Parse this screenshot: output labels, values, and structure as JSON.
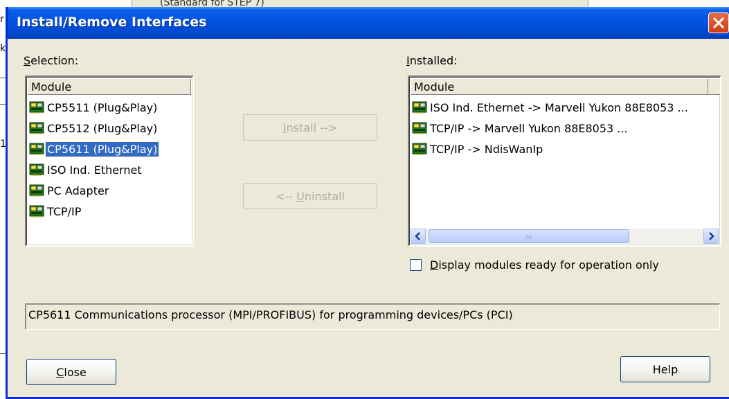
{
  "window": {
    "title": "Install/Remove Interfaces",
    "background_strip_text": "(Standard for STEP 7)",
    "close_glyph": "X"
  },
  "selection": {
    "label": "Selection:",
    "label_access_key": "S",
    "label_rest": "election:",
    "column_header": "Module",
    "items": [
      {
        "label": "CP5511 (Plug&Play)",
        "icon": "network-card-icon"
      },
      {
        "label": "CP5512 (Plug&Play)",
        "icon": "network-card-icon"
      },
      {
        "label": "CP5611 (Plug&Play)",
        "icon": "network-card-icon",
        "selected": true
      },
      {
        "label": "ISO Ind. Ethernet",
        "icon": "network-card-icon"
      },
      {
        "label": "PC Adapter",
        "icon": "network-card-icon"
      },
      {
        "label": "TCP/IP",
        "icon": "network-card-icon"
      }
    ]
  },
  "buttons": {
    "install_access_key": "I",
    "install_rest": "nstall -->",
    "install_enabled": false,
    "uninstall_prefix": "<-- ",
    "uninstall_access_key": "U",
    "uninstall_rest": "ninstall",
    "uninstall_enabled": false,
    "close_access_key": "C",
    "close_rest": "lose",
    "help": "Help"
  },
  "installed": {
    "label_access_key": "I",
    "label_rest": "nstalled:",
    "column_header": "Module",
    "items": [
      {
        "label": "ISO Ind. Ethernet -> Marvell Yukon 88E8053 ...",
        "icon": "network-card-icon"
      },
      {
        "label": "TCP/IP -> Marvell Yukon 88E8053 ...",
        "icon": "network-card-icon"
      },
      {
        "label": "TCP/IP -> NdisWanIp",
        "icon": "network-card-icon"
      }
    ]
  },
  "options": {
    "ready_only_access_key": "D",
    "ready_only_rest": "isplay modules ready for operation only",
    "ready_only_checked": false
  },
  "status": {
    "description": "CP5611 Communications processor (MPI/PROFIBUS) for programming devices/PCs (PCI)"
  },
  "colors": {
    "titlebar": "#0054e3",
    "selection_highlight": "#316ac5",
    "dialog_face": "#ece9d8"
  }
}
